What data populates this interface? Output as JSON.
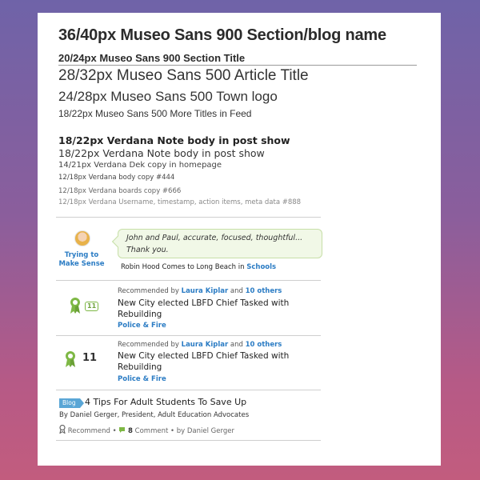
{
  "typography": {
    "section_blog_name": "36/40px Museo Sans 900 Section/blog name",
    "section_title": "20/24px Museo Sans 900 Section Title",
    "article_title": "28/32px Museo Sans 500 Article Title",
    "town_logo": "24/28px Museo Sans 500 Town logo",
    "more_titles": "18/22px Museo Sans 500 More Titles in Feed",
    "note_body_bold": "18/22px Verdana Note body in post show",
    "note_body": "18/22px Verdana Note body in post show",
    "dek_copy": "14/21px Verdana Dek copy in homepage",
    "body_copy": "12/18px Verdana body copy #444",
    "boards_copy": "12/18px Verdana boards copy #666",
    "meta_copy": "12/18px Verdana Username, timestamp, action items, meta data #888"
  },
  "feed": {
    "quote_item": {
      "author_label": "Trying to Make Sense",
      "quote": "John and Paul, accurate, focused, thoughtful... Thank you.",
      "story_title": "Robin Hood Comes to Long Beach",
      "in_word": "in",
      "section": "Schools"
    },
    "rec_items": [
      {
        "count": "11",
        "recommended_by_prefix": "Recommended by",
        "recommender": "Laura Kiplar",
        "and_word": "and",
        "others": "10 others",
        "title": "New City elected LBFD Chief Tasked with Rebuilding",
        "category": "Police & Fire"
      },
      {
        "count": "11",
        "recommended_by_prefix": "Recommended by",
        "recommender": "Laura Kiplar",
        "and_word": "and",
        "others": "10 others",
        "title": "New City elected LBFD Chief Tasked with Rebuilding",
        "category": "Police & Fire"
      }
    ],
    "blog_item": {
      "tag": "Blog",
      "title": "4 Tips For Adult Students To Save Up",
      "byline": "By Daniel Gerger, President, Adult Education Advocates",
      "recommend": "Recommend",
      "comment_count": "8",
      "comment_label": "Comment",
      "by_author": "• by Daniel Gerger"
    }
  },
  "colors": {
    "link_blue": "#2b7cc4",
    "accent_green": "#7eb845",
    "bubble_bg": "#f1f8e7"
  },
  "icons": [
    "ribbon-icon",
    "comment-icon",
    "avatar"
  ]
}
